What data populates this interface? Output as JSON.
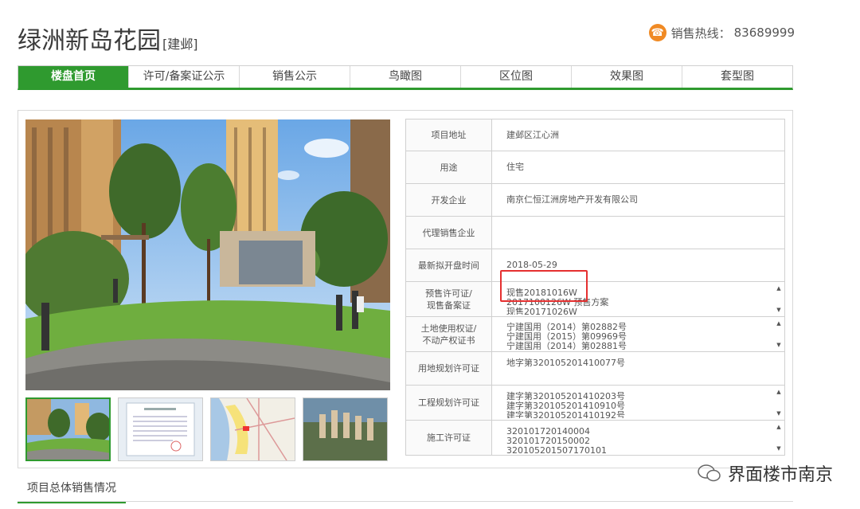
{
  "header": {
    "project_name": "绿洲新岛花园",
    "district_tag": "[建邺]",
    "hotline_label": "销售热线：",
    "hotline_number": "83689999"
  },
  "tabs": [
    {
      "label": "楼盘首页",
      "active": true
    },
    {
      "label": "许可/备案证公示"
    },
    {
      "label": "销售公示"
    },
    {
      "label": "鸟瞰图"
    },
    {
      "label": "区位图"
    },
    {
      "label": "效果图"
    },
    {
      "label": "套型图"
    }
  ],
  "info": {
    "rows": [
      {
        "label": "项目地址",
        "value": "建邺区江心洲"
      },
      {
        "label": "用途",
        "value": "住宅"
      },
      {
        "label": "开发企业",
        "value": "南京仁恒江洲房地产开发有限公司"
      },
      {
        "label": "代理销售企业",
        "value": ""
      },
      {
        "label": "最新拟开盘时间",
        "value": "2018-05-29"
      },
      {
        "label_lines": [
          "预售许可证/",
          "现售备案证"
        ],
        "values": [
          "现售20181016W",
          "2017100126W    预售方案",
          "现售20171026W"
        ]
      },
      {
        "label_lines": [
          "土地使用权证/",
          "不动产权证书"
        ],
        "values": [
          "宁建国用（2014）第02882号",
          "宁建国用（2015）第09969号",
          "宁建国用（2014）第02881号"
        ]
      },
      {
        "label": "用地规划许可证",
        "value": "地字第320105201410077号"
      },
      {
        "label": "工程规划许可证",
        "values": [
          "建字第320105201410203号",
          "建字第320105201410910号",
          "建字第320105201410192号"
        ]
      },
      {
        "label": "施工许可证",
        "values": [
          "320101720140004",
          "320101720150002",
          "320105201507170101"
        ]
      }
    ]
  },
  "section": {
    "sales_overview": "项目总体销售情况"
  },
  "watermark": {
    "text": "界面楼市南京"
  },
  "colors": {
    "accent": "#2f9a2f",
    "highlight": "#e53030",
    "phone": "#f08a24"
  }
}
